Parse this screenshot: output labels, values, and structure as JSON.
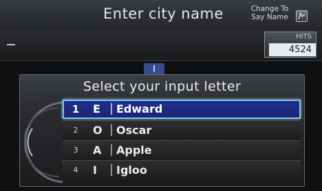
{
  "header": {
    "title": "Enter city name",
    "change_to_line1": "Change To",
    "change_to_line2": "Say Name"
  },
  "hits": {
    "label": "HITS",
    "value": "4524"
  },
  "dialog": {
    "title": "Select your input letter",
    "items": [
      {
        "num": "1",
        "letter": "E",
        "word": "Edward",
        "selected": true
      },
      {
        "num": "2",
        "letter": "O",
        "word": "Oscar",
        "selected": false
      },
      {
        "num": "3",
        "letter": "A",
        "word": "Apple",
        "selected": false
      },
      {
        "num": "4",
        "letter": "I",
        "word": "Igloo",
        "selected": false
      }
    ]
  },
  "colors": {
    "selection": "#1f2f8a",
    "selection_border": "#7ec7f0",
    "hits_bg": "#e9ecee"
  }
}
